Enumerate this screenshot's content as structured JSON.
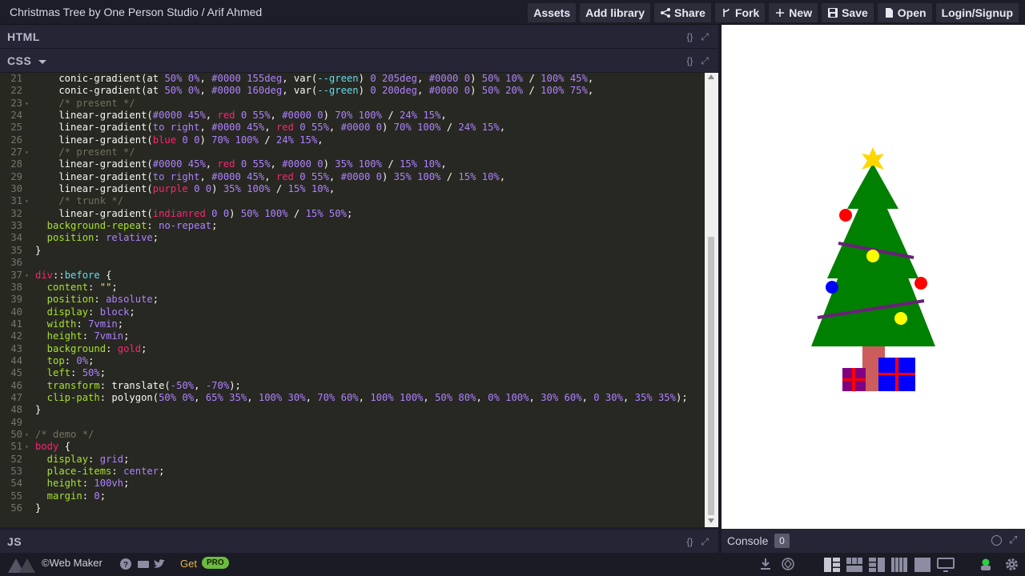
{
  "window": {
    "title": "Christmas Tree by One Person Studio / Arif Ahmed"
  },
  "toolbar": {
    "assets": "Assets",
    "add_library": "Add library",
    "share": "Share",
    "fork": "Fork",
    "new": "New",
    "save": "Save",
    "open": "Open",
    "login": "Login/Signup"
  },
  "panes": {
    "html_label": "HTML",
    "css_label": "CSS",
    "js_label": "JS",
    "tools_format": "{}",
    "tools_expand": "⤢"
  },
  "editor": {
    "lines": [
      {
        "n": "21",
        "fold": "",
        "segs": [
          [
            "    conic-gradient(at ",
            "p"
          ],
          [
            "50% 0%",
            "v"
          ],
          [
            ", ",
            "p"
          ],
          [
            "#0000 155deg",
            "v"
          ],
          [
            ", var(",
            "p"
          ],
          [
            "--green",
            "r"
          ],
          [
            ") ",
            "p"
          ],
          [
            "0 205deg",
            "v"
          ],
          [
            ", ",
            "p"
          ],
          [
            "#0000 0",
            "v"
          ],
          [
            ") ",
            "p"
          ],
          [
            "50% 10%",
            "v"
          ],
          [
            " / ",
            "p"
          ],
          [
            "100% 45%",
            "v"
          ],
          [
            ",",
            "p"
          ]
        ]
      },
      {
        "n": "22",
        "fold": "",
        "segs": [
          [
            "    conic-gradient(at ",
            "p"
          ],
          [
            "50% 0%",
            "v"
          ],
          [
            ", ",
            "p"
          ],
          [
            "#0000 160deg",
            "v"
          ],
          [
            ", var(",
            "p"
          ],
          [
            "--green",
            "r"
          ],
          [
            ") ",
            "p"
          ],
          [
            "0 200deg",
            "v"
          ],
          [
            ", ",
            "p"
          ],
          [
            "#0000 0",
            "v"
          ],
          [
            ") ",
            "p"
          ],
          [
            "50% 20%",
            "v"
          ],
          [
            " / ",
            "p"
          ],
          [
            "100% 75%",
            "v"
          ],
          [
            ",",
            "p"
          ]
        ]
      },
      {
        "n": "23",
        "fold": "▾",
        "segs": [
          [
            "    /* present */",
            "c"
          ]
        ]
      },
      {
        "n": "24",
        "fold": "",
        "segs": [
          [
            "    linear-gradient(",
            "p"
          ],
          [
            "#0000 45%",
            "v"
          ],
          [
            ", ",
            "p"
          ],
          [
            "red",
            "k"
          ],
          [
            " ",
            "p"
          ],
          [
            "0 55%",
            "v"
          ],
          [
            ", ",
            "p"
          ],
          [
            "#0000 0",
            "v"
          ],
          [
            ") ",
            "p"
          ],
          [
            "70% 100%",
            "v"
          ],
          [
            " / ",
            "p"
          ],
          [
            "24% 15%",
            "v"
          ],
          [
            ",",
            "p"
          ]
        ]
      },
      {
        "n": "25",
        "fold": "",
        "segs": [
          [
            "    linear-gradient(",
            "p"
          ],
          [
            "to right",
            "v"
          ],
          [
            ", ",
            "p"
          ],
          [
            "#0000 45%",
            "v"
          ],
          [
            ", ",
            "p"
          ],
          [
            "red",
            "k"
          ],
          [
            " ",
            "p"
          ],
          [
            "0 55%",
            "v"
          ],
          [
            ", ",
            "p"
          ],
          [
            "#0000 0",
            "v"
          ],
          [
            ") ",
            "p"
          ],
          [
            "70% 100%",
            "v"
          ],
          [
            " / ",
            "p"
          ],
          [
            "24% 15%",
            "v"
          ],
          [
            ",",
            "p"
          ]
        ]
      },
      {
        "n": "26",
        "fold": "",
        "segs": [
          [
            "    linear-gradient(",
            "p"
          ],
          [
            "blue",
            "k"
          ],
          [
            " ",
            "p"
          ],
          [
            "0 0",
            "v"
          ],
          [
            ") ",
            "p"
          ],
          [
            "70% 100%",
            "v"
          ],
          [
            " / ",
            "p"
          ],
          [
            "24% 15%",
            "v"
          ],
          [
            ",",
            "p"
          ]
        ]
      },
      {
        "n": "27",
        "fold": "▾",
        "segs": [
          [
            "    /* present */",
            "c"
          ]
        ]
      },
      {
        "n": "28",
        "fold": "",
        "segs": [
          [
            "    linear-gradient(",
            "p"
          ],
          [
            "#0000 45%",
            "v"
          ],
          [
            ", ",
            "p"
          ],
          [
            "red",
            "k"
          ],
          [
            " ",
            "p"
          ],
          [
            "0 55%",
            "v"
          ],
          [
            ", ",
            "p"
          ],
          [
            "#0000 0",
            "v"
          ],
          [
            ") ",
            "p"
          ],
          [
            "35% 100%",
            "v"
          ],
          [
            " / ",
            "p"
          ],
          [
            "15% 10%",
            "v"
          ],
          [
            ",",
            "p"
          ]
        ]
      },
      {
        "n": "29",
        "fold": "",
        "segs": [
          [
            "    linear-gradient(",
            "p"
          ],
          [
            "to right",
            "v"
          ],
          [
            ", ",
            "p"
          ],
          [
            "#0000 45%",
            "v"
          ],
          [
            ", ",
            "p"
          ],
          [
            "red",
            "k"
          ],
          [
            " ",
            "p"
          ],
          [
            "0 55%",
            "v"
          ],
          [
            ", ",
            "p"
          ],
          [
            "#0000 0",
            "v"
          ],
          [
            ") ",
            "p"
          ],
          [
            "35% 100%",
            "v"
          ],
          [
            " / ",
            "p"
          ],
          [
            "15% 10%",
            "v"
          ],
          [
            ",",
            "p"
          ]
        ]
      },
      {
        "n": "30",
        "fold": "",
        "segs": [
          [
            "    linear-gradient(",
            "p"
          ],
          [
            "purple",
            "k"
          ],
          [
            " ",
            "p"
          ],
          [
            "0 0",
            "v"
          ],
          [
            ") ",
            "p"
          ],
          [
            "35% 100%",
            "v"
          ],
          [
            " / ",
            "p"
          ],
          [
            "15% 10%",
            "v"
          ],
          [
            ",",
            "p"
          ]
        ]
      },
      {
        "n": "31",
        "fold": "▾",
        "segs": [
          [
            "    /* trunk */",
            "c"
          ]
        ]
      },
      {
        "n": "32",
        "fold": "",
        "segs": [
          [
            "    linear-gradient(",
            "p"
          ],
          [
            "indianred",
            "k"
          ],
          [
            " ",
            "p"
          ],
          [
            "0 0",
            "v"
          ],
          [
            ") ",
            "p"
          ],
          [
            "50% 100%",
            "v"
          ],
          [
            " / ",
            "p"
          ],
          [
            "15% 50%",
            "v"
          ],
          [
            ";",
            "p"
          ]
        ]
      },
      {
        "n": "33",
        "fold": "",
        "segs": [
          [
            "  background-repeat",
            "g"
          ],
          [
            ": ",
            "p"
          ],
          [
            "no-repeat",
            "v"
          ],
          [
            ";",
            "p"
          ]
        ]
      },
      {
        "n": "34",
        "fold": "",
        "segs": [
          [
            "  position",
            "g"
          ],
          [
            ": ",
            "p"
          ],
          [
            "relative",
            "v"
          ],
          [
            ";",
            "p"
          ]
        ]
      },
      {
        "n": "35",
        "fold": "",
        "segs": [
          [
            "}",
            "p"
          ]
        ]
      },
      {
        "n": "36",
        "fold": "",
        "segs": [
          [
            "",
            "p"
          ]
        ]
      },
      {
        "n": "37",
        "fold": "▾",
        "segs": [
          [
            "div",
            "k"
          ],
          [
            "::",
            "p"
          ],
          [
            "before",
            "s"
          ],
          [
            " {",
            "p"
          ]
        ]
      },
      {
        "n": "38",
        "fold": "",
        "segs": [
          [
            "  content",
            "g"
          ],
          [
            ": ",
            "p"
          ],
          [
            "\"\"",
            "y"
          ],
          [
            ";",
            "p"
          ]
        ]
      },
      {
        "n": "39",
        "fold": "",
        "segs": [
          [
            "  position",
            "g"
          ],
          [
            ": ",
            "p"
          ],
          [
            "absolute",
            "v"
          ],
          [
            ";",
            "p"
          ]
        ]
      },
      {
        "n": "40",
        "fold": "",
        "segs": [
          [
            "  display",
            "g"
          ],
          [
            ": ",
            "p"
          ],
          [
            "block",
            "v"
          ],
          [
            ";",
            "p"
          ]
        ]
      },
      {
        "n": "41",
        "fold": "",
        "segs": [
          [
            "  width",
            "g"
          ],
          [
            ": ",
            "p"
          ],
          [
            "7vmin",
            "v"
          ],
          [
            ";",
            "p"
          ]
        ]
      },
      {
        "n": "42",
        "fold": "",
        "segs": [
          [
            "  height",
            "g"
          ],
          [
            ": ",
            "p"
          ],
          [
            "7vmin",
            "v"
          ],
          [
            ";",
            "p"
          ]
        ]
      },
      {
        "n": "43",
        "fold": "",
        "segs": [
          [
            "  background",
            "g"
          ],
          [
            ": ",
            "p"
          ],
          [
            "gold",
            "k"
          ],
          [
            ";",
            "p"
          ]
        ]
      },
      {
        "n": "44",
        "fold": "",
        "segs": [
          [
            "  top",
            "g"
          ],
          [
            ": ",
            "p"
          ],
          [
            "0%",
            "v"
          ],
          [
            ";",
            "p"
          ]
        ]
      },
      {
        "n": "45",
        "fold": "",
        "segs": [
          [
            "  left",
            "g"
          ],
          [
            ": ",
            "p"
          ],
          [
            "50%",
            "v"
          ],
          [
            ";",
            "p"
          ]
        ]
      },
      {
        "n": "46",
        "fold": "",
        "segs": [
          [
            "  transform",
            "g"
          ],
          [
            ": translate(",
            "p"
          ],
          [
            "-50%",
            "v"
          ],
          [
            ", ",
            "p"
          ],
          [
            "-70%",
            "v"
          ],
          [
            ");",
            "p"
          ]
        ]
      },
      {
        "n": "47",
        "fold": "",
        "segs": [
          [
            "  clip-path",
            "g"
          ],
          [
            ": polygon(",
            "p"
          ],
          [
            "50% 0%",
            "v"
          ],
          [
            ", ",
            "p"
          ],
          [
            "65% 35%",
            "v"
          ],
          [
            ", ",
            "p"
          ],
          [
            "100% 30%",
            "v"
          ],
          [
            ", ",
            "p"
          ],
          [
            "70% 60%",
            "v"
          ],
          [
            ", ",
            "p"
          ],
          [
            "100% 100%",
            "v"
          ],
          [
            ", ",
            "p"
          ],
          [
            "50% 80%",
            "v"
          ],
          [
            ", ",
            "p"
          ],
          [
            "0% 100%",
            "v"
          ],
          [
            ", ",
            "p"
          ],
          [
            "30% 60%",
            "v"
          ],
          [
            ", ",
            "p"
          ],
          [
            "0 30%",
            "v"
          ],
          [
            ", ",
            "p"
          ],
          [
            "35% 35%",
            "v"
          ],
          [
            ");",
            "p"
          ]
        ]
      },
      {
        "n": "48",
        "fold": "",
        "segs": [
          [
            "}",
            "p"
          ]
        ]
      },
      {
        "n": "49",
        "fold": "",
        "segs": [
          [
            "",
            "p"
          ]
        ]
      },
      {
        "n": "50",
        "fold": "▾",
        "segs": [
          [
            "/* demo */",
            "c"
          ]
        ]
      },
      {
        "n": "51",
        "fold": "▾",
        "segs": [
          [
            "body",
            "k"
          ],
          [
            " {",
            "p"
          ]
        ]
      },
      {
        "n": "52",
        "fold": "",
        "segs": [
          [
            "  display",
            "g"
          ],
          [
            ": ",
            "p"
          ],
          [
            "grid",
            "v"
          ],
          [
            ";",
            "p"
          ]
        ]
      },
      {
        "n": "53",
        "fold": "",
        "segs": [
          [
            "  place-items",
            "g"
          ],
          [
            ": ",
            "p"
          ],
          [
            "center",
            "v"
          ],
          [
            ";",
            "p"
          ]
        ]
      },
      {
        "n": "54",
        "fold": "",
        "segs": [
          [
            "  height",
            "g"
          ],
          [
            ": ",
            "p"
          ],
          [
            "100vh",
            "v"
          ],
          [
            ";",
            "p"
          ]
        ]
      },
      {
        "n": "55",
        "fold": "",
        "segs": [
          [
            "  margin",
            "g"
          ],
          [
            ": ",
            "p"
          ],
          [
            "0",
            "v"
          ],
          [
            ";",
            "p"
          ]
        ]
      },
      {
        "n": "56",
        "fold": "",
        "segs": [
          [
            "}",
            "p"
          ]
        ]
      }
    ]
  },
  "console": {
    "label": "Console",
    "count": "0"
  },
  "footer": {
    "brand": "©Web Maker",
    "get": "Get",
    "pro": "PRO"
  },
  "colors": {
    "tree": "#008000",
    "star": "gold",
    "trunk": "indianred",
    "ornament_red": "#ff0000",
    "ornament_yellow": "#ffff00",
    "ornament_blue": "#0000ff",
    "garland": "#6b1f7a",
    "present_large": "#0000ff",
    "present_small": "#800080"
  }
}
